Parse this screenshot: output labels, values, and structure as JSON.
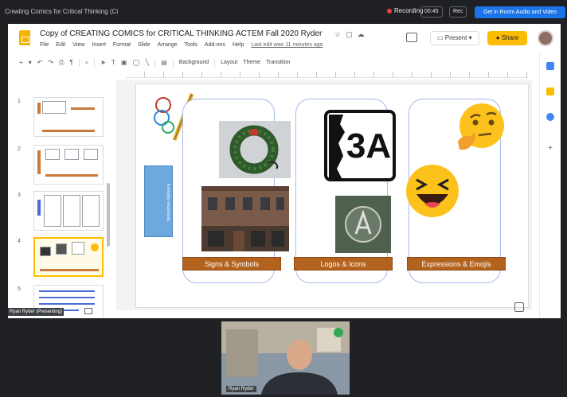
{
  "meeting": {
    "title": "Creating Comics for Critical Thinking (Ci",
    "recording_label": "Recording",
    "buttons": [
      "00:45",
      "Rec"
    ],
    "primary_button": "Get in Room Audio and Video"
  },
  "slides_app": {
    "doc_title": "Copy of CREATING COMICS for CRITICAL THINKING ACTEM Fall 2020 Ryder",
    "menu": [
      "File",
      "Edit",
      "View",
      "Insert",
      "Format",
      "Slide",
      "Arrange",
      "Tools",
      "Add-ons",
      "Help"
    ],
    "last_edit": "Last edit was 11 minutes ago",
    "present_label": "Present",
    "share_label": "Share",
    "toolbar": {
      "background": "Background",
      "layout": "Layout",
      "theme": "Theme",
      "transition": "Transition"
    },
    "slide_numbers": [
      "1",
      "2",
      "3",
      "4",
      "5"
    ],
    "presenter_tag": "Ryan Ryder (Presenting)"
  },
  "slide": {
    "vertical_text": "Everyday visual texts",
    "labels": [
      "Signs & Symbols",
      "Logos & Icons",
      "Expressions & Emojis"
    ],
    "sign_text": "3A"
  },
  "participant": {
    "name": "Ryan Ryder"
  },
  "colors": {
    "accent_brown": "#b4631f",
    "share_yellow": "#fbbc04",
    "meet_blue": "#1a73e8",
    "column_border": "#a8b8ee"
  }
}
